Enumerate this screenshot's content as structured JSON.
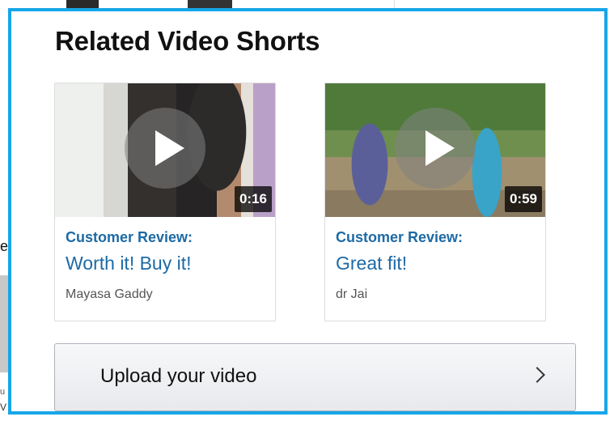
{
  "section": {
    "title": "Related Video Shorts"
  },
  "videos": [
    {
      "duration": "0:16",
      "review_label": "Customer Review:",
      "review_title": "Worth it! Buy it!",
      "reviewer": "Mayasa Gaddy"
    },
    {
      "duration": "0:59",
      "review_label": "Customer Review:",
      "review_title": "Great fit!",
      "reviewer": "dr Jai"
    }
  ],
  "upload": {
    "label": "Upload your video",
    "icon": "chevron-right-icon"
  },
  "background": {
    "left_letter": "e",
    "small_text_1": "u",
    "small_text_2": "V"
  },
  "colors": {
    "highlight_border": "#16a6e8",
    "link": "#1d6aa5"
  }
}
